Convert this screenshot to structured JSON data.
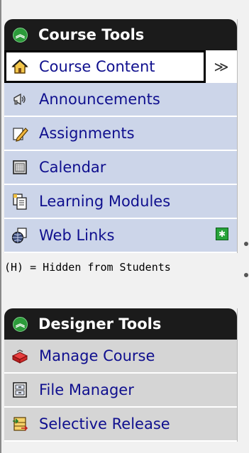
{
  "course_tools": {
    "title": "Course Tools",
    "items": [
      {
        "label": "Course Content",
        "icon": "house-icon",
        "active": true
      },
      {
        "label": "Announcements",
        "icon": "megaphone-icon"
      },
      {
        "label": "Assignments",
        "icon": "pencil-icon"
      },
      {
        "label": "Calendar",
        "icon": "calendar-icon"
      },
      {
        "label": "Learning Modules",
        "icon": "document-stack-icon"
      },
      {
        "label": "Web Links",
        "icon": "globe-icon"
      }
    ],
    "expand_symbol": "≫",
    "add_symbol": "✱"
  },
  "hidden_note": "(H) = Hidden from Students",
  "designer_tools": {
    "title": "Designer Tools",
    "items": [
      {
        "label": "Manage Course",
        "icon": "toolbox-icon"
      },
      {
        "label": "File Manager",
        "icon": "file-cabinet-icon"
      },
      {
        "label": "Selective Release",
        "icon": "release-icon"
      }
    ]
  },
  "colors": {
    "header_bg": "#1b1b1b",
    "course_item_bg": "#ccd5e9",
    "designer_item_bg": "#d5d5d5",
    "link_text": "#0f0f8e",
    "chevron_green": "#2c9b3a"
  }
}
